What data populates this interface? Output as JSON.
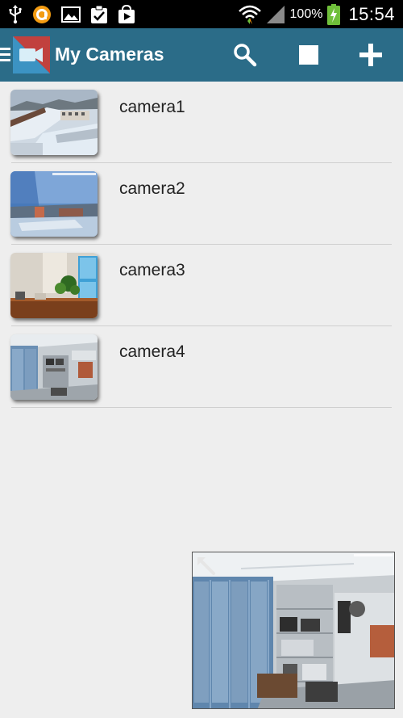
{
  "status_bar": {
    "battery": "100%",
    "time": "15:54",
    "left_icons": [
      "usb-icon",
      "browser-notification-icon",
      "gallery-icon",
      "task-done-icon",
      "play-store-icon"
    ],
    "right_icons": [
      "wifi-icon",
      "signal-icon",
      "battery-charging-icon"
    ]
  },
  "app_bar": {
    "title": "My Cameras",
    "actions": [
      "search-icon",
      "stop-icon",
      "add-icon"
    ],
    "background": "#2b6c88"
  },
  "cameras": [
    {
      "name": "camera1",
      "thumbnail": "snowy-rooftops"
    },
    {
      "name": "camera2",
      "thumbnail": "city-view-with-timestamp"
    },
    {
      "name": "camera3",
      "thumbnail": "office-with-plants"
    },
    {
      "name": "camera4",
      "thumbnail": "office-shelves"
    }
  ],
  "preview": {
    "thumbnail": "office-shelves-live",
    "control": "expand-icon"
  }
}
